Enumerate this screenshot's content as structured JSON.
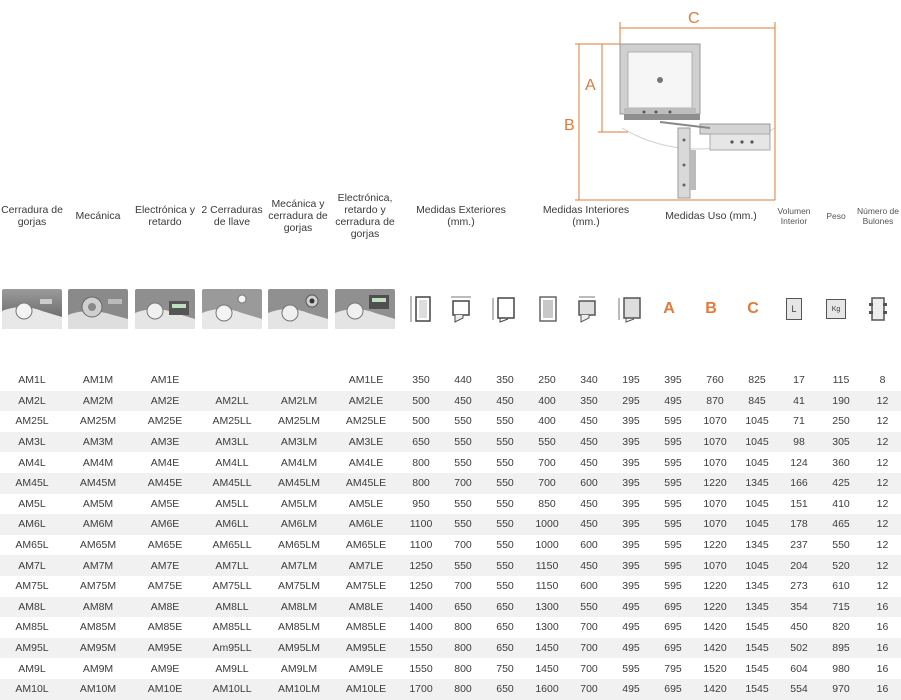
{
  "diagram": {
    "labels": {
      "a": "A",
      "b": "B",
      "c": "C"
    }
  },
  "headers": [
    "Cerradura de gorjas",
    "Mecánica",
    "Electrónica y retardo",
    "2 Cerraduras de llave",
    "Mecánica y cerradura de gorjas",
    "Electrónica, retardo y cerradura de gorjas",
    "Medidas Exteriores (mm.)",
    "Medidas Interiores (mm.)",
    "Medidas Uso (mm.)",
    "Volumen Interior",
    "Peso",
    "Número de Bulones"
  ],
  "icons": {
    "letters": [
      "A",
      "B",
      "C"
    ],
    "volume_label": "L",
    "weight_label": "Kg",
    "names": [
      "ext-height-icon",
      "ext-width-icon",
      "ext-depth-icon",
      "int-height-icon",
      "int-width-icon",
      "int-depth-icon"
    ]
  },
  "rows": [
    [
      "AM1L",
      "AM1M",
      "AM1E",
      "",
      "",
      "AM1LE",
      "350",
      "440",
      "350",
      "250",
      "340",
      "195",
      "395",
      "760",
      "825",
      "17",
      "115",
      "8"
    ],
    [
      "AM2L",
      "AM2M",
      "AM2E",
      "AM2LL",
      "AM2LM",
      "AM2LE",
      "500",
      "450",
      "450",
      "400",
      "350",
      "295",
      "495",
      "870",
      "845",
      "41",
      "190",
      "12"
    ],
    [
      "AM25L",
      "AM25M",
      "AM25E",
      "AM25LL",
      "AM25LM",
      "AM25LE",
      "500",
      "550",
      "550",
      "400",
      "450",
      "395",
      "595",
      "1070",
      "1045",
      "71",
      "250",
      "12"
    ],
    [
      "AM3L",
      "AM3M",
      "AM3E",
      "AM3LL",
      "AM3LM",
      "AM3LE",
      "650",
      "550",
      "550",
      "550",
      "450",
      "395",
      "595",
      "1070",
      "1045",
      "98",
      "305",
      "12"
    ],
    [
      "AM4L",
      "AM4M",
      "AM4E",
      "AM4LL",
      "AM4LM",
      "AM4LE",
      "800",
      "550",
      "550",
      "700",
      "450",
      "395",
      "595",
      "1070",
      "1045",
      "124",
      "360",
      "12"
    ],
    [
      "AM45L",
      "AM45M",
      "AM45E",
      "AM45LL",
      "AM45LM",
      "AM45LE",
      "800",
      "700",
      "550",
      "700",
      "600",
      "395",
      "595",
      "1220",
      "1345",
      "166",
      "425",
      "12"
    ],
    [
      "AM5L",
      "AM5M",
      "AM5E",
      "AM5LL",
      "AM5LM",
      "AM5LE",
      "950",
      "550",
      "550",
      "850",
      "450",
      "395",
      "595",
      "1070",
      "1045",
      "151",
      "410",
      "12"
    ],
    [
      "AM6L",
      "AM6M",
      "AM6E",
      "AM6LL",
      "AM6LM",
      "AM6LE",
      "1100",
      "550",
      "550",
      "1000",
      "450",
      "395",
      "595",
      "1070",
      "1045",
      "178",
      "465",
      "12"
    ],
    [
      "AM65L",
      "AM65M",
      "AM65E",
      "AM65LL",
      "AM65LM",
      "AM65LE",
      "1100",
      "700",
      "550",
      "1000",
      "600",
      "395",
      "595",
      "1220",
      "1345",
      "237",
      "550",
      "12"
    ],
    [
      "AM7L",
      "AM7M",
      "AM7E",
      "AM7LL",
      "AM7LM",
      "AM7LE",
      "1250",
      "550",
      "550",
      "1150",
      "450",
      "395",
      "595",
      "1070",
      "1045",
      "204",
      "520",
      "12"
    ],
    [
      "AM75L",
      "AM75M",
      "AM75E",
      "AM75LL",
      "AM75LM",
      "AM75LE",
      "1250",
      "700",
      "550",
      "1150",
      "600",
      "395",
      "595",
      "1220",
      "1345",
      "273",
      "610",
      "12"
    ],
    [
      "AM8L",
      "AM8M",
      "AM8E",
      "AM8LL",
      "AM8LM",
      "AM8LE",
      "1400",
      "650",
      "650",
      "1300",
      "550",
      "495",
      "695",
      "1220",
      "1345",
      "354",
      "715",
      "16"
    ],
    [
      "AM85L",
      "AM85M",
      "AM85E",
      "AM85LL",
      "AM85LM",
      "AM85LE",
      "1400",
      "800",
      "650",
      "1300",
      "700",
      "495",
      "695",
      "1420",
      "1545",
      "450",
      "820",
      "16"
    ],
    [
      "AM95L",
      "AM95M",
      "AM95E",
      "Am95LL",
      "AM95LM",
      "AM95LE",
      "1550",
      "800",
      "650",
      "1450",
      "700",
      "495",
      "695",
      "1420",
      "1545",
      "502",
      "895",
      "16"
    ],
    [
      "AM9L",
      "AM9M",
      "AM9E",
      "AM9LL",
      "AM9LM",
      "AM9LE",
      "1550",
      "800",
      "750",
      "1450",
      "700",
      "595",
      "795",
      "1520",
      "1545",
      "604",
      "980",
      "16"
    ],
    [
      "AM10L",
      "AM10M",
      "AM10E",
      "AM10LL",
      "AM10LM",
      "AM10LE",
      "1700",
      "800",
      "650",
      "1600",
      "700",
      "495",
      "695",
      "1420",
      "1545",
      "554",
      "970",
      "16"
    ]
  ],
  "colors": {
    "accent": "#e07b3a",
    "stripe": "#f1f1f1",
    "text": "#3c3c3c"
  }
}
